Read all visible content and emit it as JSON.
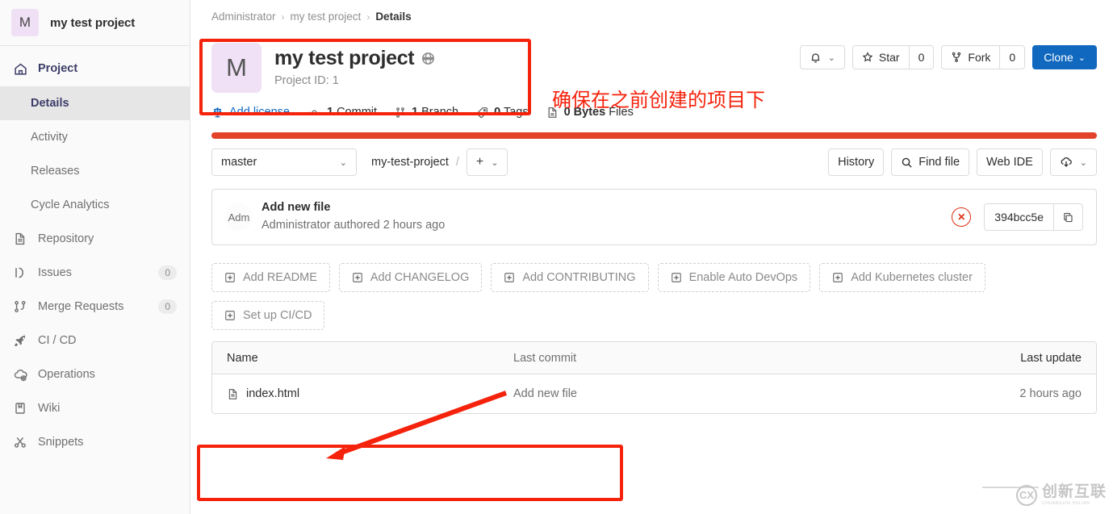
{
  "sidebar": {
    "project": {
      "avatar_letter": "M",
      "name": "my test project"
    },
    "items": [
      {
        "label": "Project",
        "icon": "home-icon",
        "type": "section",
        "badge": null
      },
      {
        "label": "Details",
        "icon": null,
        "type": "sub",
        "active": true,
        "badge": null
      },
      {
        "label": "Activity",
        "icon": null,
        "type": "sub",
        "badge": null
      },
      {
        "label": "Releases",
        "icon": null,
        "type": "sub",
        "badge": null
      },
      {
        "label": "Cycle Analytics",
        "icon": null,
        "type": "sub",
        "badge": null
      },
      {
        "label": "Repository",
        "icon": "doc-icon",
        "type": "item",
        "badge": null
      },
      {
        "label": "Issues",
        "icon": "issues-icon",
        "type": "item",
        "badge": "0"
      },
      {
        "label": "Merge Requests",
        "icon": "merge-icon",
        "type": "item",
        "badge": "0"
      },
      {
        "label": "CI / CD",
        "icon": "rocket-icon",
        "type": "item",
        "badge": null
      },
      {
        "label": "Operations",
        "icon": "operations-icon",
        "type": "item",
        "badge": null
      },
      {
        "label": "Wiki",
        "icon": "book-icon",
        "type": "item",
        "badge": null
      },
      {
        "label": "Snippets",
        "icon": "scissors-icon",
        "type": "item",
        "badge": null
      }
    ]
  },
  "breadcrumb": {
    "items": [
      "Administrator",
      "my test project",
      "Details"
    ],
    "separator": "›"
  },
  "project_header": {
    "avatar_letter": "M",
    "title": "my test project",
    "visibility_icon": "globe-icon",
    "project_id": "Project ID: 1"
  },
  "header_actions": {
    "notification_icon": "bell-icon",
    "star_label": "Star",
    "star_count": "0",
    "star_icon": "star-icon",
    "fork_label": "Fork",
    "fork_count": "0",
    "fork_icon": "fork-icon",
    "clone_label": "Clone"
  },
  "stats": [
    {
      "icon": "scale-icon",
      "text": "Add license",
      "link": true
    },
    {
      "icon": "commit-icon",
      "strong": "1",
      "text": "Commit"
    },
    {
      "icon": "branch-icon",
      "strong": "1",
      "text": "Branch"
    },
    {
      "icon": "tag-icon",
      "strong": "0",
      "text": "Tags"
    },
    {
      "icon": "files-icon",
      "strong": "0 Bytes",
      "text": "Files"
    }
  ],
  "language_bar_color": "#e24329",
  "file_toolbar": {
    "branch": "master",
    "path_root": "my-test-project",
    "path_sep": "/",
    "plus_label": "+",
    "history_label": "History",
    "find_file_label": "Find file",
    "find_file_icon": "search-icon",
    "web_ide_label": "Web IDE",
    "download_icon": "download-icon"
  },
  "commit": {
    "avatar_alt": "Adm",
    "title": "Add new file",
    "meta": "Administrator authored 2 hours ago",
    "pipeline_status": "failed",
    "pipeline_icon": "x-circle-icon",
    "sha": "394bcc5e",
    "copy_icon": "copy-icon"
  },
  "quick_actions": {
    "row1": [
      "Add README",
      "Add CHANGELOG",
      "Add CONTRIBUTING",
      "Enable Auto DevOps",
      "Add Kubernetes cluster"
    ],
    "row2": [
      "Set up CI/CD"
    ]
  },
  "file_table": {
    "columns": {
      "name": "Name",
      "last_commit": "Last commit",
      "last_update": "Last update"
    },
    "rows": [
      {
        "name": "index.html",
        "icon": "file-icon",
        "last_commit": "Add new file",
        "last_update": "2 hours ago"
      }
    ]
  },
  "annotations": {
    "note_text": "确保在之前创建的项目下",
    "color": "#f5220c"
  },
  "watermark": {
    "logo": "CX",
    "text": "创新互联",
    "subtext": "CHUANGXIN HULIAN"
  }
}
